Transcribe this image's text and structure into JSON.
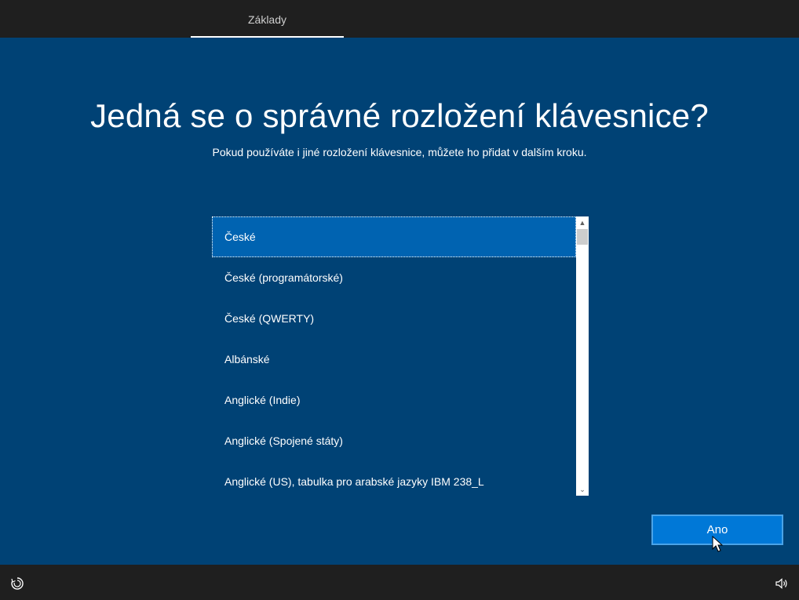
{
  "header": {
    "tab_label": "Základy"
  },
  "main": {
    "title": "Jedná se o správné rozložení klávesnice?",
    "subtitle": "Pokud používáte i jiné rozložení klávesnice, můžete ho přidat v dalším kroku."
  },
  "layout_list": {
    "items": [
      {
        "label": "České",
        "selected": true
      },
      {
        "label": "České (programátorské)",
        "selected": false
      },
      {
        "label": "České (QWERTY)",
        "selected": false
      },
      {
        "label": "Albánské",
        "selected": false
      },
      {
        "label": "Anglické (Indie)",
        "selected": false
      },
      {
        "label": "Anglické (Spojené státy)",
        "selected": false
      },
      {
        "label": "Anglické (US), tabulka pro arabské jazyky IBM 238_L",
        "selected": false
      }
    ]
  },
  "actions": {
    "yes_label": "Ano"
  },
  "footer": {
    "ease_of_access_icon": "ease-of-access-icon",
    "volume_icon": "volume-icon"
  },
  "colors": {
    "background": "#004275",
    "selection": "#0063b1",
    "button": "#0078d7",
    "bars": "#1f1f1f"
  }
}
